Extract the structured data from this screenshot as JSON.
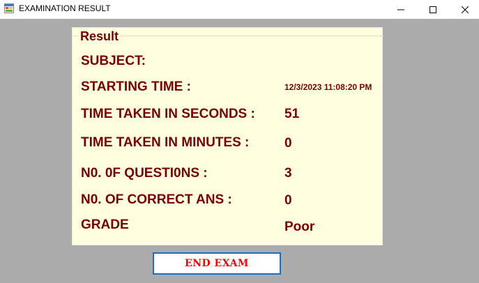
{
  "window": {
    "title": "EXAMINATION RESULT",
    "app_icon": "form-app-icon",
    "controls": [
      "minimize-icon",
      "maximize-icon",
      "close-icon"
    ]
  },
  "result_group": {
    "title": "Result",
    "rows": [
      {
        "label": "SUBJECT:",
        "value": ""
      },
      {
        "label": "STARTING TIME :",
        "value": "12/3/2023 11:08:20 PM"
      },
      {
        "label": "TIME TAKEN IN SECONDS :",
        "value": "51"
      },
      {
        "label": "TIME TAKEN IN MINUTES :",
        "value": "0"
      },
      {
        "label": "N0. 0F QUESTI0NS :",
        "value": "3"
      },
      {
        "label": "N0. OF CORRECT ANS :",
        "value": "0"
      },
      {
        "label": "GRADE",
        "value": "Poor"
      }
    ]
  },
  "end_button": {
    "label": "END EXAM"
  },
  "colors": {
    "background": "#ababab",
    "panel": "#ffffe0",
    "text": "#7a0000",
    "button_text": "#ff0000",
    "button_border": "#1e6ec8"
  }
}
